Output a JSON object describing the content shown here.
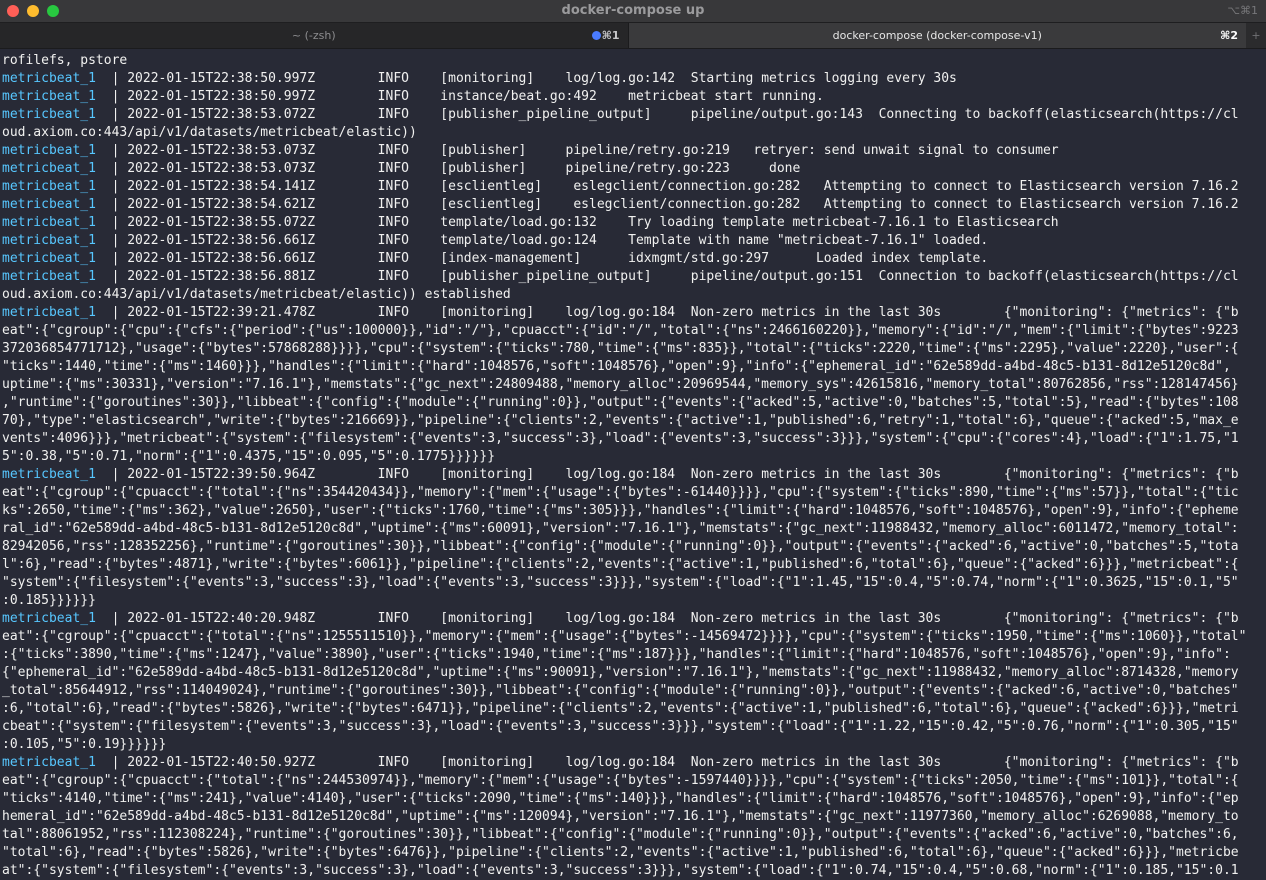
{
  "window": {
    "title": "docker-compose up",
    "shortcut": "⌥⌘1"
  },
  "tabs": [
    {
      "label": "~ (-zsh)",
      "shortcut": "⌘1"
    },
    {
      "label": "docker-compose (docker-compose-v1)",
      "shortcut": "⌘2"
    }
  ],
  "new_tab": "+",
  "terminal": {
    "lines": [
      {
        "svc": "",
        "text": "rofilefs, pstore"
      },
      {
        "svc": "metricbeat_1",
        "text": "  | 2022-01-15T22:38:50.997Z        INFO    [monitoring]    log/log.go:142  Starting metrics logging every 30s"
      },
      {
        "svc": "metricbeat_1",
        "text": "  | 2022-01-15T22:38:50.997Z        INFO    instance/beat.go:492    metricbeat start running."
      },
      {
        "svc": "metricbeat_1",
        "text": "  | 2022-01-15T22:38:53.072Z        INFO    [publisher_pipeline_output]     pipeline/output.go:143  Connecting to backoff(elasticsearch(https://cl"
      },
      {
        "svc": "",
        "text": "oud.axiom.co:443/api/v1/datasets/metricbeat/elastic))"
      },
      {
        "svc": "metricbeat_1",
        "text": "  | 2022-01-15T22:38:53.073Z        INFO    [publisher]     pipeline/retry.go:219   retryer: send unwait signal to consumer"
      },
      {
        "svc": "metricbeat_1",
        "text": "  | 2022-01-15T22:38:53.073Z        INFO    [publisher]     pipeline/retry.go:223     done"
      },
      {
        "svc": "metricbeat_1",
        "text": "  | 2022-01-15T22:38:54.141Z        INFO    [esclientleg]    eslegclient/connection.go:282   Attempting to connect to Elasticsearch version 7.16.2"
      },
      {
        "svc": "metricbeat_1",
        "text": "  | 2022-01-15T22:38:54.621Z        INFO    [esclientleg]    eslegclient/connection.go:282   Attempting to connect to Elasticsearch version 7.16.2"
      },
      {
        "svc": "metricbeat_1",
        "text": "  | 2022-01-15T22:38:55.072Z        INFO    template/load.go:132    Try loading template metricbeat-7.16.1 to Elasticsearch"
      },
      {
        "svc": "metricbeat_1",
        "text": "  | 2022-01-15T22:38:56.661Z        INFO    template/load.go:124    Template with name \"metricbeat-7.16.1\" loaded."
      },
      {
        "svc": "metricbeat_1",
        "text": "  | 2022-01-15T22:38:56.661Z        INFO    [index-management]      idxmgmt/std.go:297      Loaded index template."
      },
      {
        "svc": "metricbeat_1",
        "text": "  | 2022-01-15T22:38:56.881Z        INFO    [publisher_pipeline_output]     pipeline/output.go:151  Connection to backoff(elasticsearch(https://cl"
      },
      {
        "svc": "",
        "text": "oud.axiom.co:443/api/v1/datasets/metricbeat/elastic)) established"
      },
      {
        "svc": "metricbeat_1",
        "text": "  | 2022-01-15T22:39:21.478Z        INFO    [monitoring]    log/log.go:184  Non-zero metrics in the last 30s        {\"monitoring\": {\"metrics\": {\"b"
      },
      {
        "svc": "",
        "text": "eat\":{\"cgroup\":{\"cpu\":{\"cfs\":{\"period\":{\"us\":100000}},\"id\":\"/\"},\"cpuacct\":{\"id\":\"/\",\"total\":{\"ns\":2466160220}},\"memory\":{\"id\":\"/\",\"mem\":{\"limit\":{\"bytes\":9223"
      },
      {
        "svc": "",
        "text": "372036854771712},\"usage\":{\"bytes\":57868288}}}},\"cpu\":{\"system\":{\"ticks\":780,\"time\":{\"ms\":835}},\"total\":{\"ticks\":2220,\"time\":{\"ms\":2295},\"value\":2220},\"user\":{"
      },
      {
        "svc": "",
        "text": "\"ticks\":1440,\"time\":{\"ms\":1460}}},\"handles\":{\"limit\":{\"hard\":1048576,\"soft\":1048576},\"open\":9},\"info\":{\"ephemeral_id\":\"62e589dd-a4bd-48c5-b131-8d12e5120c8d\","
      },
      {
        "svc": "",
        "text": "uptime\":{\"ms\":30331},\"version\":\"7.16.1\"},\"memstats\":{\"gc_next\":24809488,\"memory_alloc\":20969544,\"memory_sys\":42615816,\"memory_total\":80762856,\"rss\":128147456}"
      },
      {
        "svc": "",
        "text": ",\"runtime\":{\"goroutines\":30}},\"libbeat\":{\"config\":{\"module\":{\"running\":0}},\"output\":{\"events\":{\"acked\":5,\"active\":0,\"batches\":5,\"total\":5},\"read\":{\"bytes\":108"
      },
      {
        "svc": "",
        "text": "70},\"type\":\"elasticsearch\",\"write\":{\"bytes\":216669}},\"pipeline\":{\"clients\":2,\"events\":{\"active\":1,\"published\":6,\"retry\":1,\"total\":6},\"queue\":{\"acked\":5,\"max_e"
      },
      {
        "svc": "",
        "text": "vents\":4096}}},\"metricbeat\":{\"system\":{\"filesystem\":{\"events\":3,\"success\":3},\"load\":{\"events\":3,\"success\":3}}},\"system\":{\"cpu\":{\"cores\":4},\"load\":{\"1\":1.75,\"1"
      },
      {
        "svc": "",
        "text": "5\":0.38,\"5\":0.71,\"norm\":{\"1\":0.4375,\"15\":0.095,\"5\":0.1775}}}}}}"
      },
      {
        "svc": "metricbeat_1",
        "text": "  | 2022-01-15T22:39:50.964Z        INFO    [monitoring]    log/log.go:184  Non-zero metrics in the last 30s        {\"monitoring\": {\"metrics\": {\"b"
      },
      {
        "svc": "",
        "text": "eat\":{\"cgroup\":{\"cpuacct\":{\"total\":{\"ns\":354420434}},\"memory\":{\"mem\":{\"usage\":{\"bytes\":-61440}}}},\"cpu\":{\"system\":{\"ticks\":890,\"time\":{\"ms\":57}},\"total\":{\"tic"
      },
      {
        "svc": "",
        "text": "ks\":2650,\"time\":{\"ms\":362},\"value\":2650},\"user\":{\"ticks\":1760,\"time\":{\"ms\":305}}},\"handles\":{\"limit\":{\"hard\":1048576,\"soft\":1048576},\"open\":9},\"info\":{\"epheme"
      },
      {
        "svc": "",
        "text": "ral_id\":\"62e589dd-a4bd-48c5-b131-8d12e5120c8d\",\"uptime\":{\"ms\":60091},\"version\":\"7.16.1\"},\"memstats\":{\"gc_next\":11988432,\"memory_alloc\":6011472,\"memory_total\":"
      },
      {
        "svc": "",
        "text": "82942056,\"rss\":128352256},\"runtime\":{\"goroutines\":30}},\"libbeat\":{\"config\":{\"module\":{\"running\":0}},\"output\":{\"events\":{\"acked\":6,\"active\":0,\"batches\":5,\"tota"
      },
      {
        "svc": "",
        "text": "l\":6},\"read\":{\"bytes\":4871},\"write\":{\"bytes\":6061}},\"pipeline\":{\"clients\":2,\"events\":{\"active\":1,\"published\":6,\"total\":6},\"queue\":{\"acked\":6}}},\"metricbeat\":{"
      },
      {
        "svc": "",
        "text": "\"system\":{\"filesystem\":{\"events\":3,\"success\":3},\"load\":{\"events\":3,\"success\":3}}},\"system\":{\"load\":{\"1\":1.45,\"15\":0.4,\"5\":0.74,\"norm\":{\"1\":0.3625,\"15\":0.1,\"5\""
      },
      {
        "svc": "",
        "text": ":0.185}}}}}}"
      },
      {
        "svc": "metricbeat_1",
        "text": "  | 2022-01-15T22:40:20.948Z        INFO    [monitoring]    log/log.go:184  Non-zero metrics in the last 30s        {\"monitoring\": {\"metrics\": {\"b"
      },
      {
        "svc": "",
        "text": "eat\":{\"cgroup\":{\"cpuacct\":{\"total\":{\"ns\":1255511510}},\"memory\":{\"mem\":{\"usage\":{\"bytes\":-14569472}}}},\"cpu\":{\"system\":{\"ticks\":1950,\"time\":{\"ms\":1060}},\"total\""
      },
      {
        "svc": "",
        "text": ":{\"ticks\":3890,\"time\":{\"ms\":1247},\"value\":3890},\"user\":{\"ticks\":1940,\"time\":{\"ms\":187}}},\"handles\":{\"limit\":{\"hard\":1048576,\"soft\":1048576},\"open\":9},\"info\":"
      },
      {
        "svc": "",
        "text": "{\"ephemeral_id\":\"62e589dd-a4bd-48c5-b131-8d12e5120c8d\",\"uptime\":{\"ms\":90091},\"version\":\"7.16.1\"},\"memstats\":{\"gc_next\":11988432,\"memory_alloc\":8714328,\"memory"
      },
      {
        "svc": "",
        "text": "_total\":85644912,\"rss\":114049024},\"runtime\":{\"goroutines\":30}},\"libbeat\":{\"config\":{\"module\":{\"running\":0}},\"output\":{\"events\":{\"acked\":6,\"active\":0,\"batches\""
      },
      {
        "svc": "",
        "text": ":6,\"total\":6},\"read\":{\"bytes\":5826},\"write\":{\"bytes\":6471}},\"pipeline\":{\"clients\":2,\"events\":{\"active\":1,\"published\":6,\"total\":6},\"queue\":{\"acked\":6}}},\"metri"
      },
      {
        "svc": "",
        "text": "cbeat\":{\"system\":{\"filesystem\":{\"events\":3,\"success\":3},\"load\":{\"events\":3,\"success\":3}}},\"system\":{\"load\":{\"1\":1.22,\"15\":0.42,\"5\":0.76,\"norm\":{\"1\":0.305,\"15\""
      },
      {
        "svc": "",
        "text": ":0.105,\"5\":0.19}}}}}}"
      },
      {
        "svc": "metricbeat_1",
        "text": "  | 2022-01-15T22:40:50.927Z        INFO    [monitoring]    log/log.go:184  Non-zero metrics in the last 30s        {\"monitoring\": {\"metrics\": {\"b"
      },
      {
        "svc": "",
        "text": "eat\":{\"cgroup\":{\"cpuacct\":{\"total\":{\"ns\":244530974}},\"memory\":{\"mem\":{\"usage\":{\"bytes\":-1597440}}}},\"cpu\":{\"system\":{\"ticks\":2050,\"time\":{\"ms\":101}},\"total\":{"
      },
      {
        "svc": "",
        "text": "\"ticks\":4140,\"time\":{\"ms\":241},\"value\":4140},\"user\":{\"ticks\":2090,\"time\":{\"ms\":140}}},\"handles\":{\"limit\":{\"hard\":1048576,\"soft\":1048576},\"open\":9},\"info\":{\"ep"
      },
      {
        "svc": "",
        "text": "hemeral_id\":\"62e589dd-a4bd-48c5-b131-8d12e5120c8d\",\"uptime\":{\"ms\":120094},\"version\":\"7.16.1\"},\"memstats\":{\"gc_next\":11977360,\"memory_alloc\":6269088,\"memory_to"
      },
      {
        "svc": "",
        "text": "tal\":88061952,\"rss\":112308224},\"runtime\":{\"goroutines\":30}},\"libbeat\":{\"config\":{\"module\":{\"running\":0}},\"output\":{\"events\":{\"acked\":6,\"active\":0,\"batches\":6,"
      },
      {
        "svc": "",
        "text": "\"total\":6},\"read\":{\"bytes\":5826},\"write\":{\"bytes\":6476}},\"pipeline\":{\"clients\":2,\"events\":{\"active\":1,\"published\":6,\"total\":6},\"queue\":{\"acked\":6}}},\"metricbe"
      },
      {
        "svc": "",
        "text": "at\":{\"system\":{\"filesystem\":{\"events\":3,\"success\":3},\"load\":{\"events\":3,\"success\":3}}},\"system\":{\"load\":{\"1\":0.74,\"15\":0.4,\"5\":0.68,\"norm\":{\"1\":0.185,\"15\":0.1"
      }
    ]
  }
}
